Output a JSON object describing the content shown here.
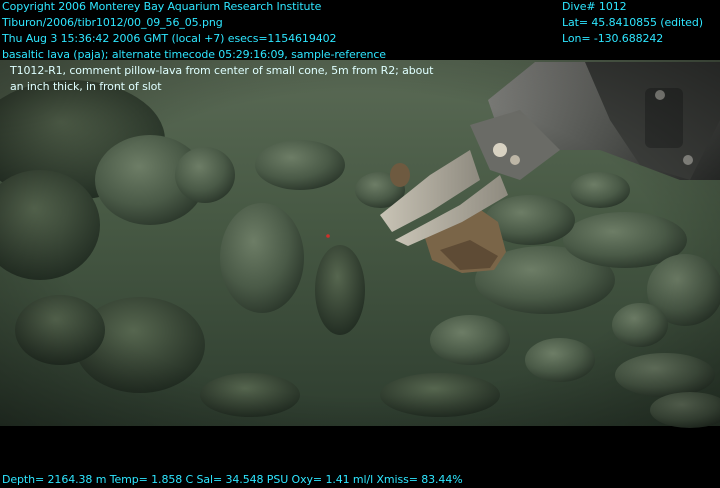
{
  "header": {
    "copyright": "Copyright 2006 Monterey Bay Aquarium Research Institute",
    "file_path": "Tiburon/2006/tibr1012/00_09_56_05.png",
    "datetime": "Thu Aug  3 15:36:42 2006 GMT (local +7)  esecs=1154619402",
    "description": "basaltic lava (paja); alternate timecode 05:29:16:09, sample-reference",
    "comment_line1": "T1012-R1, comment pillow-lava from center of small cone, 5m from R2; about",
    "comment_line2": "an inch thick, in front of slot"
  },
  "position": {
    "dive": "Dive# 1012",
    "lat": "Lat= 45.8410855 (edited)",
    "lon": "Lon= -130.688242"
  },
  "footer": {
    "telemetry": "Depth= 2164.38 m  Temp= 1.858 C  Sal= 34.548 PSU  Oxy= 1.41 ml/l  Xmiss= 83.44%"
  },
  "colors": {
    "overlay_text": "#2ee6ff",
    "background": "#000000",
    "seafloor": "#3c4d3a"
  }
}
